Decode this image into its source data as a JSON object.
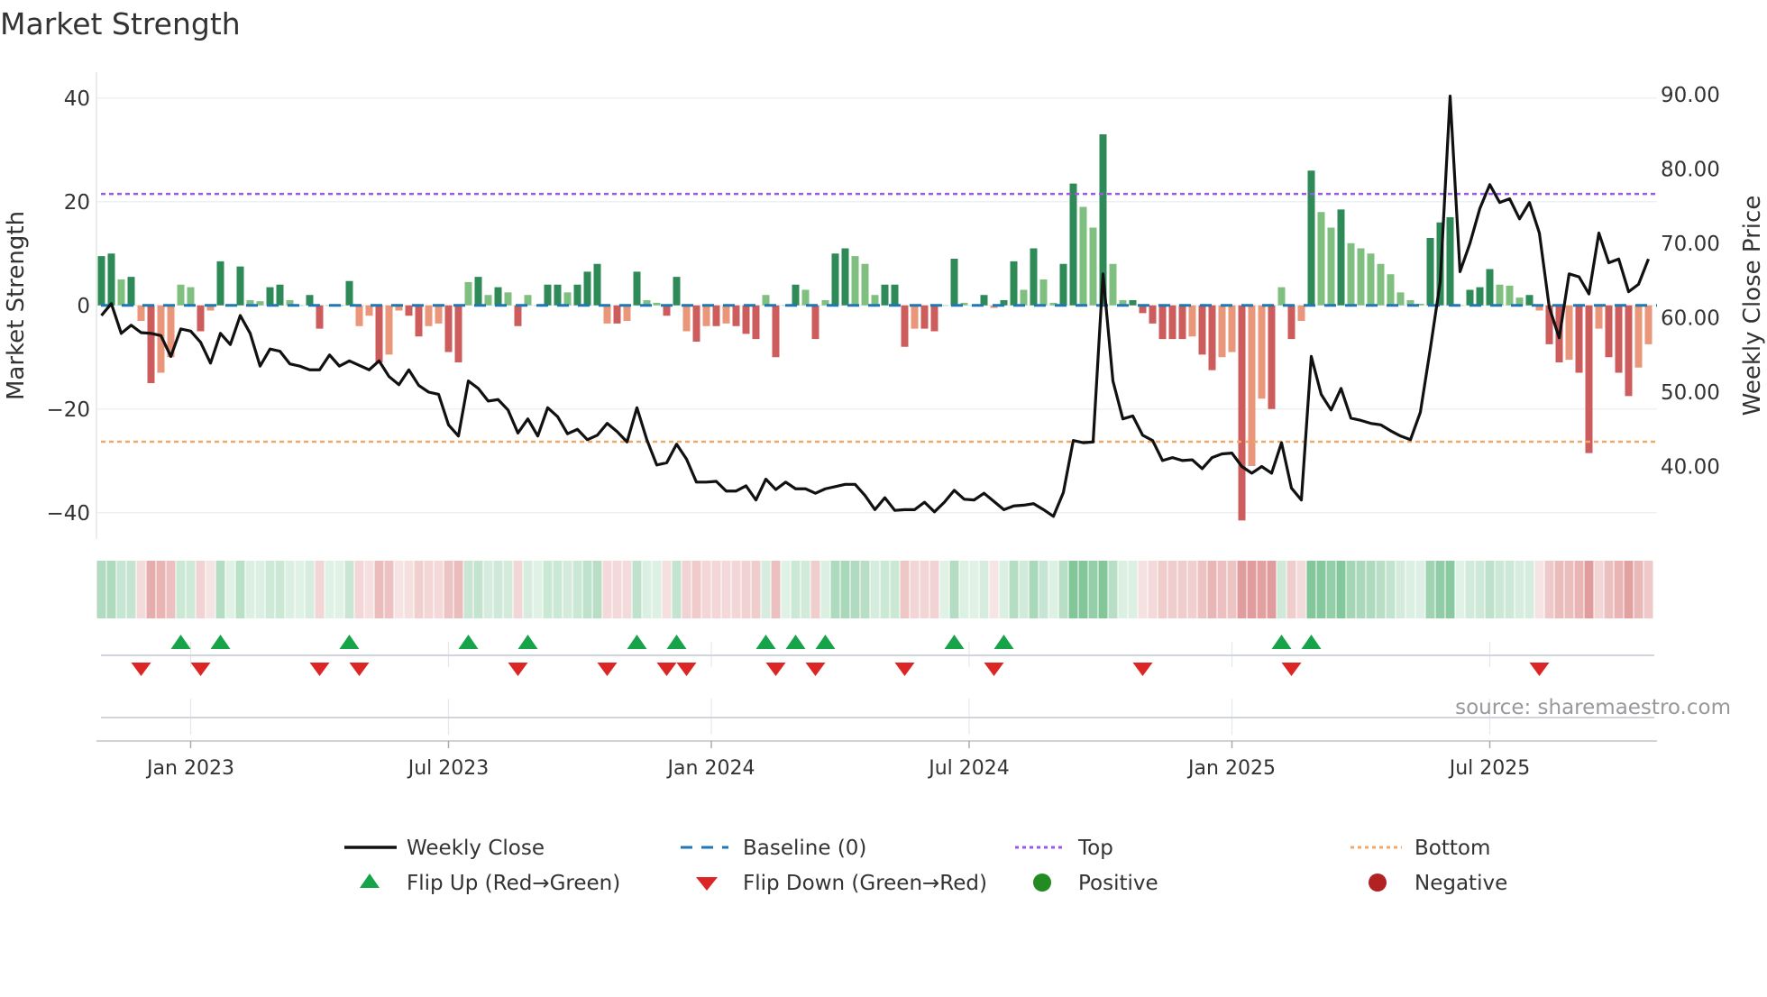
{
  "chart_data": {
    "type": "bar",
    "title": "Market Strength",
    "ylabel": "Market Strength",
    "y2label": "Weekly Close Price",
    "ylim": [
      -45,
      45
    ],
    "y2lim": [
      30.3,
      92.9
    ],
    "yticks": [
      "40",
      "20",
      "0",
      "−20",
      "−40"
    ],
    "ytick_values": [
      40,
      20,
      0,
      -20,
      -40
    ],
    "y2ticks": [
      "90.00",
      "80.00",
      "70.00",
      "60.00",
      "50.00",
      "40.00"
    ],
    "y2tick_values": [
      90,
      80,
      70,
      60,
      50,
      40
    ],
    "xticks": [
      "Jan 2023",
      "Jul 2023",
      "Jan 2024",
      "Jul 2024",
      "Jan 2025",
      "Jul 2025"
    ],
    "xtick_week_index": [
      9,
      35,
      61.5,
      87.5,
      114,
      140
    ],
    "top_threshold": 21.5,
    "bottom_threshold": -26.3,
    "source": "source: sharemaestro.com",
    "grid": true,
    "legend_position": "bottom",
    "legend": {
      "weekly_close": "Weekly Close",
      "baseline": "Baseline (0)",
      "top": "Top",
      "bottom": "Bottom",
      "flip_up": "Flip Up (Red→Green)",
      "flip_down": "Flip Down (Green→Red)",
      "positive": "Positive",
      "negative": "Negative"
    },
    "series": [
      {
        "name": "Market Strength",
        "values": [
          9.5,
          10,
          5,
          5.5,
          -3,
          -15,
          -13,
          -10,
          4,
          3.5,
          -5,
          -1,
          8.5,
          0,
          7.5,
          1,
          0.8,
          3.5,
          4,
          1,
          0,
          2,
          -4.5,
          0,
          0,
          4.7,
          -4,
          -2,
          -11,
          -9.5,
          -1,
          -2,
          -6,
          -4,
          -3.5,
          -9,
          -11,
          4.5,
          5.5,
          2,
          3.5,
          2.5,
          -4,
          2,
          0,
          4,
          4,
          2.5,
          4,
          6.5,
          8,
          -3.5,
          -3.5,
          -3,
          6.5,
          1,
          0.5,
          -2,
          5.5,
          -5,
          -7,
          -4,
          -4,
          -3.5,
          -4,
          -5.5,
          -6.5,
          2,
          -10,
          0,
          4,
          3,
          -6.5,
          1,
          10,
          11,
          9.5,
          8,
          2,
          4,
          4,
          -8,
          -4.5,
          -4.5,
          -5,
          0,
          9,
          0.5,
          0,
          2,
          -0.5,
          1,
          8.5,
          3,
          11,
          5,
          0.5,
          8,
          23.5,
          19,
          15,
          33,
          8,
          1,
          1,
          -1.5,
          -3.5,
          -6.5,
          -6.5,
          -6.5,
          -6,
          -9.5,
          -12.5,
          -10,
          -9,
          -41.5,
          -31,
          -18,
          -20,
          3.5,
          -6.5,
          -3,
          26,
          18,
          15,
          18.5,
          12,
          11,
          10,
          8,
          6,
          2.5,
          1,
          0.3,
          13,
          16,
          17,
          0,
          3,
          3.5,
          7,
          4,
          3.8,
          1.5,
          2,
          -1,
          -7.5,
          -11,
          -10.5,
          -13,
          -28.5,
          -4.5,
          -10,
          -13,
          -17.5,
          -12,
          -7.5
        ]
      },
      {
        "name": "Weekly Close",
        "values": [
          60.3,
          61.9,
          57.9,
          59,
          58,
          57.9,
          57.6,
          54.8,
          58.5,
          58.2,
          56.7,
          53.9,
          57.9,
          56.4,
          60.3,
          57.9,
          53.5,
          55.8,
          55.5,
          53.8,
          53.5,
          53,
          53,
          55,
          53.5,
          54.2,
          53.6,
          53,
          54.2,
          52.1,
          51,
          53,
          50.9,
          50,
          49.7,
          45.6,
          44.1,
          51.5,
          50.5,
          48.8,
          49,
          47.6,
          44.5,
          46.4,
          44.1,
          47.9,
          46.7,
          44.4,
          45,
          43.6,
          44.2,
          45.8,
          44.7,
          43.3,
          47.9,
          43.6,
          40.2,
          40.5,
          43,
          41,
          37.9,
          37.9,
          38,
          36.7,
          36.7,
          37.4,
          35.5,
          38.3,
          36.9,
          37.9,
          37,
          37,
          36.4,
          37,
          37.3,
          37.6,
          37.6,
          36.1,
          34.2,
          35.8,
          34.1,
          34.2,
          34.2,
          35.2,
          33.9,
          35.2,
          36.8,
          35.6,
          35.5,
          36.4,
          35.3,
          34.2,
          34.7,
          34.8,
          35,
          34.2,
          33.3,
          36.5,
          43.5,
          43.2,
          43.3,
          65.9,
          51.5,
          46.4,
          46.8,
          44.2,
          43.5,
          40.8,
          41.2,
          40.8,
          40.9,
          39.7,
          41.2,
          41.7,
          41.8,
          40,
          39.1,
          40,
          39.1,
          43.2,
          37.1,
          35.5,
          54.8,
          49.7,
          47.6,
          50.5,
          46.5,
          46.2,
          45.8,
          45.6,
          44.8,
          44.1,
          43.6,
          47.3,
          55.8,
          64.8,
          89.8,
          66.2,
          70,
          74.7,
          77.9,
          75.5,
          76,
          73.3,
          75.5,
          71.4,
          61.4,
          57.3,
          65.9,
          65.5,
          63.2,
          71.4,
          67.4,
          67.9,
          63.5,
          64.5,
          67.9
        ]
      }
    ],
    "colors": {
      "pos_strong": "#2e8b57",
      "pos_weak": "#7fbf7f",
      "neg_strong": "#cd5c5c",
      "neg_weak": "#e9967a",
      "line": "#111111",
      "baseline": "#1f77b4",
      "top": "#9b59e0",
      "bottom": "#f0a868",
      "flip_up": "#16a34a",
      "flip_down": "#dc2626",
      "positive": "#228b22",
      "negative": "#b22222"
    }
  }
}
